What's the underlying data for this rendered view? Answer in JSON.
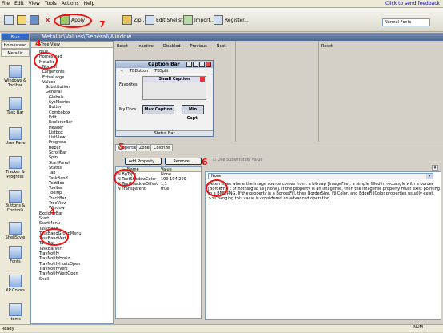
{
  "menu": [
    "File",
    "Edit",
    "View",
    "Tools",
    "Actions",
    "Help"
  ],
  "help_link": "Click to send feedback",
  "toolbar": {
    "apply": "Apply",
    "zip": "Zip...",
    "edit_shellstyle": "Edit Shellstyle",
    "import": "Import...",
    "register": "Register...",
    "normal_fonts": "Normal Fonts"
  },
  "leftbar": {
    "tabs": [
      "Blue",
      "Homestead",
      "Metallic"
    ],
    "items": [
      "Windows & Toolbar",
      "Task Bar",
      "User Pane",
      "Tracker & Progress",
      "Buttons & Controls",
      "ShellStyle",
      "Fonts",
      "XP Colors",
      "Items"
    ]
  },
  "window_title": "Metallic\\Values\\General\\Window",
  "tree": {
    "header": "Tree View",
    "nodes": [
      "Blue",
      "Homestead",
      "Metallic",
      "Normal",
      "LargeFonts",
      "ExtraLarge",
      "Values",
      "Substitution",
      "General",
      "Globals",
      "SysMetrics",
      "Button",
      "Combobox",
      "Edit",
      "ExplorerBar",
      "Header",
      "Listbox",
      "ListView",
      "Progress",
      "Rebar",
      "ScrollBar",
      "Spin",
      "StartPanel",
      "Status",
      "Tab",
      "TaskBand",
      "TextBox",
      "Toolbar",
      "Tooltip",
      "TrackBar",
      "TreeView",
      "Window",
      "ExplorerBar",
      "Start",
      "StartMenu",
      "TaskBand",
      "TaskBandGroupMenu",
      "TaskBandVert",
      "TaskBar",
      "TaskBarVert",
      "TrayNotify",
      "TrayNotifyHoriz",
      "TrayNotifyHorizOpen",
      "TrayNotifyVert",
      "TrayNotifyVertOpen",
      "Shell"
    ]
  },
  "preview": {
    "toolbar": [
      "Reset",
      "Inactive",
      "Disabled",
      "Previous",
      "Next"
    ],
    "reset2": "Reset",
    "caption_bar": "Caption Bar",
    "tb_items": [
      "TBButton",
      "TBSplit"
    ],
    "favorites": "Favorites",
    "my_docs": "My Docs",
    "small_caption": "Small Caption",
    "max_caption": "Max Caption",
    "min_caption": "Min Capti",
    "status_bar": "Status Bar"
  },
  "props": {
    "tabs": [
      "Properties",
      "Zones",
      "Colorize"
    ],
    "add_property": "Add Property...",
    "remove": "Remove...",
    "use_subst": "Use Substitution Value",
    "col_name": "Name",
    "col_value": "Value",
    "rows": [
      {
        "name": "N  BgType",
        "value": "None"
      },
      {
        "name": "N  TextShadowColor",
        "value": "199 194 209"
      },
      {
        "name": "N  TextShadowOffset",
        "value": "1,1"
      },
      {
        "name": "N  Transparent",
        "value": "true"
      }
    ],
    "dropdown_value": "None",
    "description": "Determines where the image source comes from: a bitmap [ImageFile]; a simple filled in rectangle with a border [BorderFill]; or nothing at all [None]. If the property is an ImageFile, then the ImageFile property must exist pointing to a BMP/PNG. If the property is a BorderFill, then BorderSize, FillColor, and EdgeFillColor properties usually exist.",
    "description2": ">>Changing this value is considered an advanced operation."
  },
  "status": {
    "left": "Ready",
    "right": "NUM"
  },
  "annotations": [
    "4",
    "7",
    "5",
    "6"
  ],
  "colors": {
    "annotation": "#ee1111",
    "title": "#4d6790"
  }
}
